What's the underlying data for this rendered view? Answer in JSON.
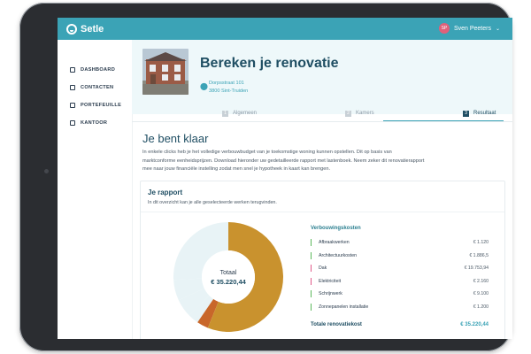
{
  "app": {
    "name": "Setle"
  },
  "user": {
    "initials": "SP",
    "name": "Sven Peeters"
  },
  "sidebar": {
    "items": [
      {
        "label": "DASHBOARD"
      },
      {
        "label": "CONTACTEN"
      },
      {
        "label": "PORTEFEUILLE"
      },
      {
        "label": "KANTOOR"
      }
    ]
  },
  "hero": {
    "title": "Bereken je renovatie",
    "address_line1": "Dorpsstraat 101",
    "address_line2": "3800 Sint-Truiden"
  },
  "tabs": [
    {
      "num": "1",
      "label": "Algemeen"
    },
    {
      "num": "2",
      "label": "Kamers"
    },
    {
      "num": "3",
      "label": "Resultaat"
    }
  ],
  "result": {
    "title": "Je bent klaar",
    "intro": "In enkele clicks heb je het volledige verbouwbudget van je toekomstige woning kunnen opstellen. Dit op basis van marktconforme eenheidsprijzen. Download hieronder uw gedetailleerde rapport met lastenboek. Neem zeker dit renovatierapport mee naar jouw financiële instelling zodat men snel je hypotheek in kaart kan brengen."
  },
  "report": {
    "title": "Je rapport",
    "subtitle": "In dit overzicht kan je alle geselecteerde werken terugvinden.",
    "donut_label": "Totaal",
    "donut_value": "€ 35.220,44",
    "costs_title": "Verbouwingskosten",
    "total_label": "Totale renovatiekost",
    "total_value": "€ 35.220,44"
  },
  "chart_data": {
    "type": "pie",
    "title": "",
    "categories": [
      "Afbraakwerken",
      "Architectuurkosten",
      "Dak",
      "Elektriciteit",
      "Schrijnwerk",
      "Zonnepanelen installatie"
    ],
    "values": [
      1120,
      1886.5,
      19753.94,
      2160,
      9100,
      1200
    ],
    "value_labels": [
      "€ 1.120",
      "€ 1.886,5",
      "€ 19.753,94",
      "€ 2.160",
      "€ 9.100",
      "€ 1.200"
    ],
    "total": 35220.44
  },
  "colors": {
    "accent": "#3ba3b6",
    "navy": "#1f4e63",
    "donut_main": "#c9922e",
    "donut_orange": "#c8672a",
    "donut_light": "#e8f3f6",
    "bar_colors": [
      "#5cb85c",
      "#5cb85c",
      "#e05a8a",
      "#e05a8a",
      "#5cb85c",
      "#5cb85c"
    ]
  }
}
